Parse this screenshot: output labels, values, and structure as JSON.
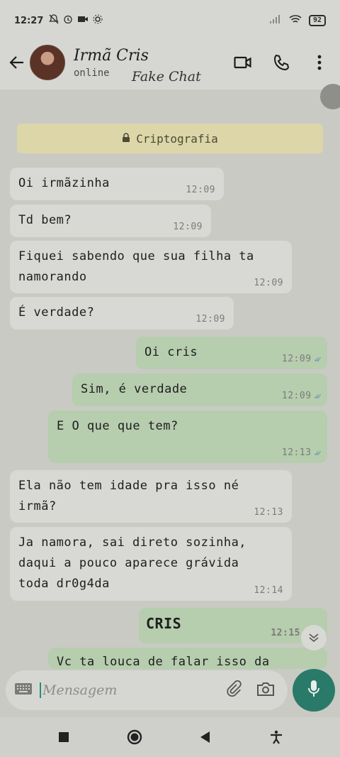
{
  "status_bar": {
    "time": "12:27",
    "left_icons": [
      "bell-off-icon",
      "alarm-icon",
      "video-camera-icon",
      "settings-icon"
    ],
    "battery": "92"
  },
  "header": {
    "contact_name": "Irmã Cris",
    "contact_status": "online",
    "overlay_text": "Fake Chat"
  },
  "encryption_banner": "Criptografia",
  "messages": [
    {
      "dir": "in",
      "text": "Oi irmãzinha",
      "time": "12:09"
    },
    {
      "dir": "in",
      "text": "Td bem?",
      "time": "12:09"
    },
    {
      "dir": "in",
      "text": "Fiquei sabendo que sua filha ta namorando",
      "time": "12:09"
    },
    {
      "dir": "in",
      "text": "É verdade?",
      "time": "12:09"
    },
    {
      "dir": "out",
      "text": "Oi cris",
      "time": "12:09"
    },
    {
      "dir": "out",
      "text": "Sim, é verdade",
      "time": "12:09"
    },
    {
      "dir": "out",
      "text": "E O que que tem?",
      "time": "12:13"
    },
    {
      "dir": "in",
      "text": "Ela não tem idade pra isso né irmã?",
      "time": "12:13"
    },
    {
      "dir": "in",
      "text": "Ja namora, sai direto sozinha, daqui a pouco aparece grávida toda dr0g4da",
      "time": "12:14"
    },
    {
      "dir": "out",
      "text": "CRIS",
      "time": "12:15"
    },
    {
      "dir": "out",
      "text": "Vc ta louca de falar isso da",
      "time": ""
    }
  ],
  "composer": {
    "placeholder": "Mensagem"
  },
  "colors": {
    "incoming_bubble": "#d8d9d4",
    "outgoing_bubble": "#b6cdae",
    "encryption_banner": "#dcd6a8",
    "accent": "#2a7a6a",
    "read_ticks": "#5b8fb4"
  }
}
